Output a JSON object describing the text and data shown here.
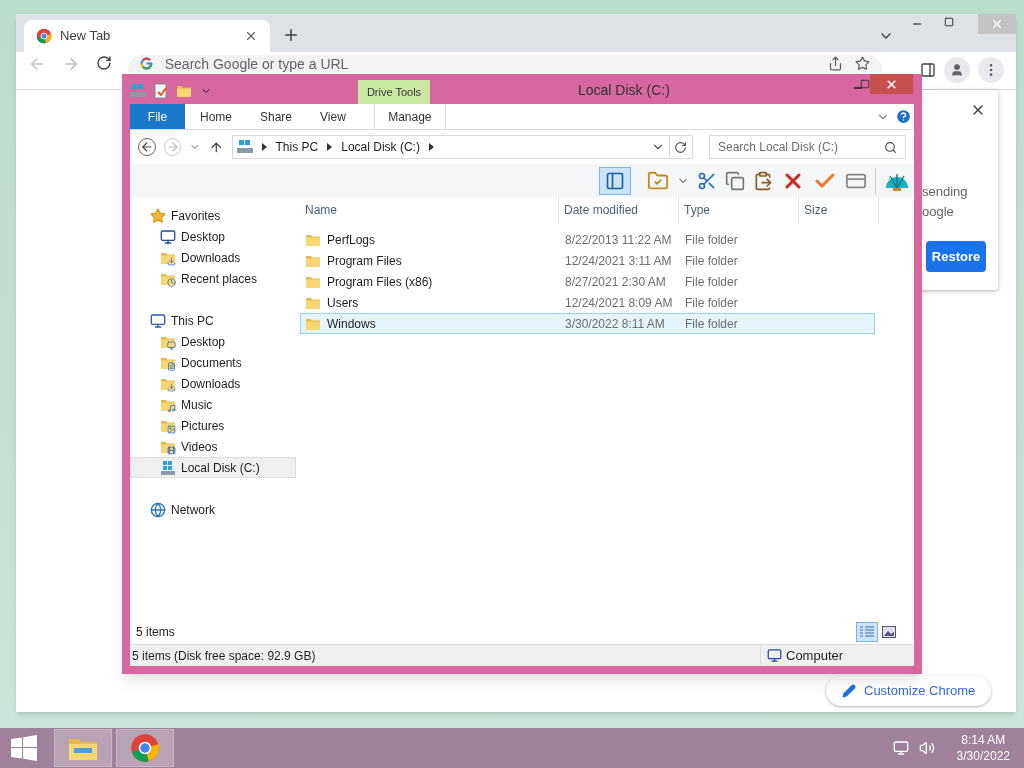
{
  "chrome": {
    "tabs": [
      {
        "title": "New Tab",
        "selected": true
      }
    ],
    "omnibox": {
      "placeholder": "Search Google or type a URL"
    },
    "panel": {
      "lines": [
        "sending",
        "oogle"
      ],
      "button": "Restore"
    },
    "customize_button": "Customize Chrome"
  },
  "explorer": {
    "title": "Local Disk (C:)",
    "context_header": "Drive Tools",
    "ribbon_tabs": [
      {
        "label": "File",
        "kind": "file",
        "selected": false
      },
      {
        "label": "Home",
        "kind": "plain",
        "selected": false
      },
      {
        "label": "Share",
        "kind": "plain",
        "selected": false
      },
      {
        "label": "View",
        "kind": "plain",
        "selected": false
      },
      {
        "label": "Manage",
        "kind": "context",
        "selected": false
      }
    ],
    "breadcrumb": [
      "This PC",
      "Local Disk (C:)"
    ],
    "search": {
      "placeholder": "Search Local Disk (C:)"
    },
    "columns": [
      "Name",
      "Date modified",
      "Type",
      "Size"
    ],
    "rows": [
      {
        "name": "PerfLogs",
        "date": "8/22/2013 11:22 AM",
        "type": "File folder",
        "selected": false
      },
      {
        "name": "Program Files",
        "date": "12/24/2021 3:11 AM",
        "type": "File folder",
        "selected": false
      },
      {
        "name": "Program Files (x86)",
        "date": "8/27/2021 2:30 AM",
        "type": "File folder",
        "selected": false
      },
      {
        "name": "Users",
        "date": "12/24/2021 8:09 AM",
        "type": "File folder",
        "selected": false
      },
      {
        "name": "Windows",
        "date": "3/30/2022 8:11 AM",
        "type": "File folder",
        "selected": true
      }
    ],
    "nav": [
      {
        "label": "Favorites",
        "selected": false,
        "children": [
          {
            "label": "Desktop",
            "selected": false
          },
          {
            "label": "Downloads",
            "selected": false
          },
          {
            "label": "Recent places",
            "selected": false
          }
        ]
      },
      {
        "label": "This PC",
        "selected": false,
        "children": [
          {
            "label": "Desktop",
            "selected": false
          },
          {
            "label": "Documents",
            "selected": false
          },
          {
            "label": "Downloads",
            "selected": false
          },
          {
            "label": "Music",
            "selected": false
          },
          {
            "label": "Pictures",
            "selected": false
          },
          {
            "label": "Videos",
            "selected": false
          },
          {
            "label": "Local Disk (C:)",
            "selected": true
          }
        ]
      },
      {
        "label": "Network",
        "selected": false
      }
    ],
    "item_count": "5 items",
    "view_buttons": [
      {
        "selected": true
      },
      {
        "selected": false
      }
    ],
    "status": {
      "left": "5 items (Disk free space: 92.9 GB)",
      "right": "Computer"
    }
  },
  "taskbar": {
    "buttons": [
      {
        "active": true
      },
      {
        "active": true
      }
    ],
    "time": "8:14 AM",
    "date": "3/30/2022"
  }
}
